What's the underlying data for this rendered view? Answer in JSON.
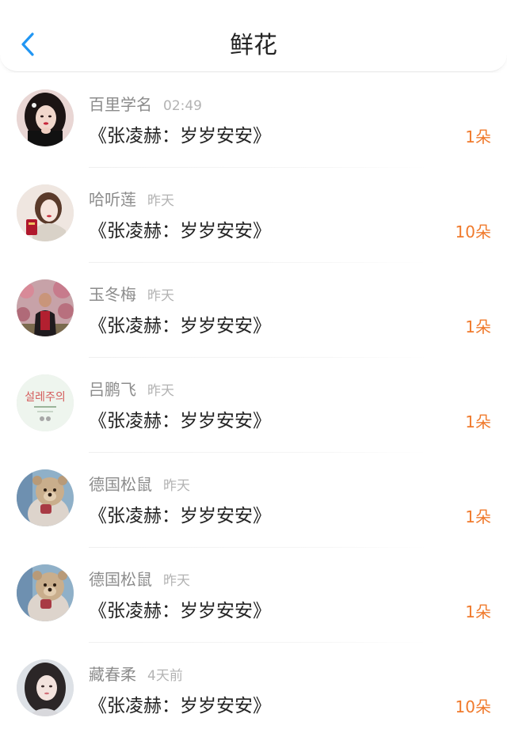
{
  "header": {
    "title": "鲜花",
    "back_icon": "chevron-left-icon",
    "accent_color": "#2196F3"
  },
  "count_color": "#F07A2C",
  "items": [
    {
      "name": "百里学名",
      "time": "02:49",
      "book": "《张凌赫：岁岁安安》",
      "count": "1朵",
      "avatar_icon": "user-photo-woman"
    },
    {
      "name": "哈听莲",
      "time": "昨天",
      "book": "《张凌赫：岁岁安安》",
      "count": "10朵",
      "avatar_icon": "user-photo-woman-scarf"
    },
    {
      "name": "玉冬梅",
      "time": "昨天",
      "book": "《张凌赫：岁岁安安》",
      "count": "1朵",
      "avatar_icon": "user-photo-blossoms"
    },
    {
      "name": "吕鹏飞",
      "time": "昨天",
      "book": "《张凌赫：岁岁安安》",
      "count": "1朵",
      "avatar_icon": "user-photo-korean-title"
    },
    {
      "name": "德国松鼠",
      "time": "昨天",
      "book": "《张凌赫：岁岁安安》",
      "count": "1朵",
      "avatar_icon": "user-photo-teddy-bear"
    },
    {
      "name": "德国松鼠",
      "time": "昨天",
      "book": "《张凌赫：岁岁安安》",
      "count": "1朵",
      "avatar_icon": "user-photo-teddy-bear"
    },
    {
      "name": "藏春柔",
      "time": "4天前",
      "book": "《张凌赫：岁岁安安》",
      "count": "10朵",
      "avatar_icon": "user-photo-girl"
    }
  ],
  "avatar_text": {
    "korean_title": "설레주의"
  }
}
